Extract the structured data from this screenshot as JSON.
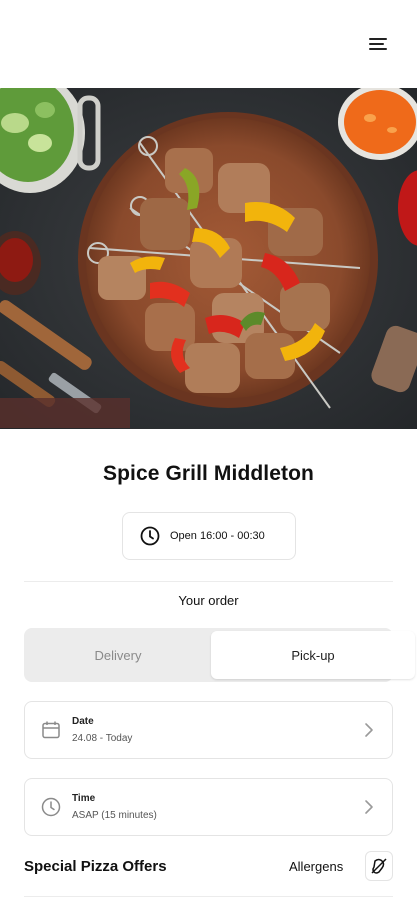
{
  "header": {
    "menu_icon": "hamburger-menu-icon"
  },
  "hero": {
    "image_subject": "grilled meat and vegetable skewers on a wooden plate",
    "colors": {
      "background": "#2f3235",
      "plate": "#8a4a2c",
      "meat": "#b07a5a",
      "pepper_red": "#d8261c",
      "pepper_yellow": "#f2b40c",
      "pepper_green": "#8aa626"
    }
  },
  "restaurant": {
    "name": "Spice Grill Middleton",
    "hours": "Open 16:00 - 00:30",
    "hours_icon": "clock-icon"
  },
  "order": {
    "title": "Your order",
    "modes": [
      {
        "label": "Delivery",
        "selected": false
      },
      {
        "label": "Pick-up",
        "selected": true
      }
    ],
    "date": {
      "label": "Date",
      "value": "24.08 - Today",
      "icon": "calendar-icon"
    },
    "time": {
      "label": "Time",
      "value": "ASAP (15 minutes)",
      "icon": "clock-icon"
    }
  },
  "menu_section": {
    "title": "Special Pizza Offers",
    "allergens_label": "Allergens",
    "allergens_icon": "allergens-icon"
  }
}
